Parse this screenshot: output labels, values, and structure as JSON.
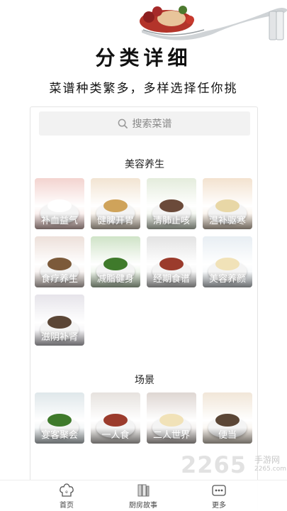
{
  "hero": {
    "title": "分类详细",
    "subtitle": "菜谱种类繁多，多样选择任你挑"
  },
  "search": {
    "placeholder": "搜索菜谱"
  },
  "sections": [
    {
      "title": "美容养生",
      "items": [
        {
          "label": "补血益气",
          "bg": "#f3d3cf"
        },
        {
          "label": "健脾开胃",
          "bg": "#f2e4d2"
        },
        {
          "label": "清肺止咳",
          "bg": "#e4ecdc"
        },
        {
          "label": "温补驱寒",
          "bg": "#f3e2cf"
        },
        {
          "label": "食疗养生",
          "bg": "#ede0da"
        },
        {
          "label": "减脂健身",
          "bg": "#cfe3c7"
        },
        {
          "label": "经期食谱",
          "bg": "#e3e3e3"
        },
        {
          "label": "美容养颜",
          "bg": "#e8eef3"
        },
        {
          "label": "滋阴补肾",
          "bg": "#e6e4ea"
        }
      ]
    },
    {
      "title": "场景",
      "items": [
        {
          "label": "宴客聚会",
          "bg": "#dfe7ea"
        },
        {
          "label": "一人食",
          "bg": "#e6e2de"
        },
        {
          "label": "二人世界",
          "bg": "#ded6d2"
        },
        {
          "label": "便当",
          "bg": "#f1e6d8"
        }
      ]
    }
  ],
  "nav": [
    {
      "label": "首页",
      "icon": "chef-hat-icon"
    },
    {
      "label": "厨房故事",
      "icon": "book-icon"
    },
    {
      "label": "更多",
      "icon": "more-icon"
    }
  ],
  "watermark": {
    "number": "2265",
    "text": "手游网",
    "url": "2265.com"
  }
}
